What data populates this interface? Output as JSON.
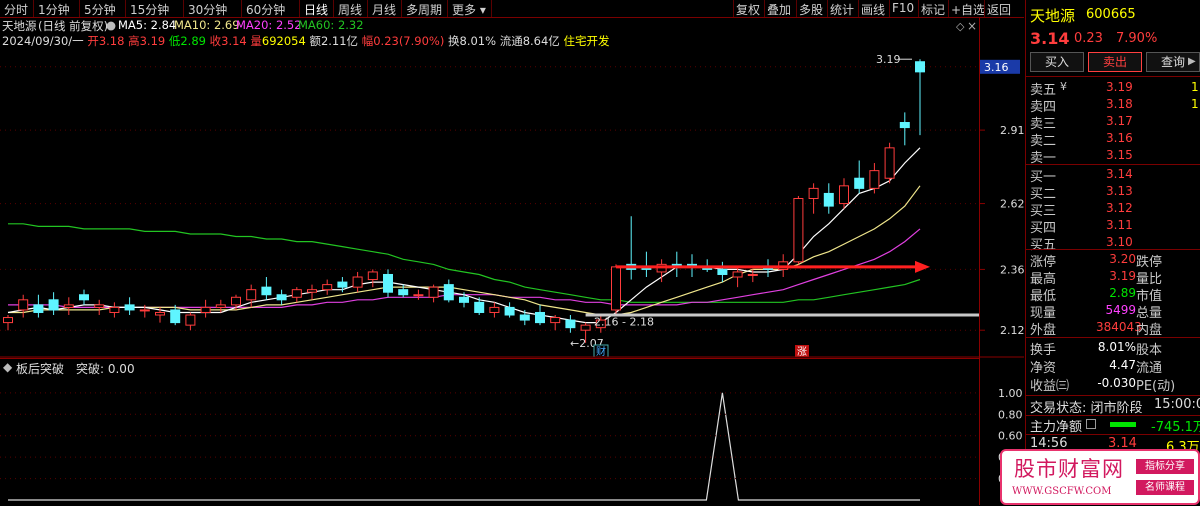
{
  "toolbar": {
    "periods": [
      "分时",
      "1分钟",
      "5分钟",
      "15分钟",
      "30分钟",
      "60分钟",
      "日线",
      "周线",
      "月线",
      "多周期",
      "更多"
    ],
    "active_period": "日线",
    "right": [
      "复权",
      "叠加",
      "多股",
      "统计",
      "画线",
      "F10",
      "标记",
      "+自选",
      "返回"
    ]
  },
  "info": {
    "name": "天地源",
    "mode": "(日线 前复权)",
    "ma5": "MA5: 2.84",
    "ma10": "MA10: 2.69",
    "ma20": "MA20: 2.52",
    "ma60": "MA60: 2.32",
    "date": "2024/09/30/一",
    "open_l": "开",
    "open": "3.18",
    "high_l": "高",
    "high": "3.19",
    "low_l": "低",
    "low": "2.89",
    "close_l": "收",
    "close": "3.14",
    "vol_l": "量",
    "vol": "692054",
    "amt": "额2.11亿",
    "amp_l": "幅",
    "amp": "0.23(7.90%)",
    "turn": "换8.01%",
    "float": "流通8.64亿",
    "sector": "住宅开发"
  },
  "price_axis": {
    "labels": [
      "3.16",
      "2.91",
      "2.62",
      "2.36",
      "2.12"
    ]
  },
  "annotations": {
    "high_label": "3.19",
    "low_label": "2.07",
    "range_label": "2.16 - 2.18",
    "cai": "财",
    "zhang": "涨"
  },
  "sub": {
    "title": "板后突破",
    "value": "突破: 0.00",
    "axis": [
      "1.00",
      "0.80",
      "0.60",
      "0.40",
      "0.20"
    ]
  },
  "chart_data": {
    "type": "candlestick",
    "series_colors": {
      "up": "#ff3c3c",
      "down": "#5ff5ff",
      "ma5": "#ffffff",
      "ma10": "#f0e68c",
      "ma20": "#e040e0",
      "ma60": "#22c422"
    },
    "candles": [
      {
        "o": 2.15,
        "h": 2.18,
        "l": 2.12,
        "c": 2.17
      },
      {
        "o": 2.2,
        "h": 2.26,
        "l": 2.17,
        "c": 2.24
      },
      {
        "o": 2.22,
        "h": 2.26,
        "l": 2.17,
        "c": 2.19
      },
      {
        "o": 2.24,
        "h": 2.27,
        "l": 2.18,
        "c": 2.2
      },
      {
        "o": 2.21,
        "h": 2.25,
        "l": 2.18,
        "c": 2.22
      },
      {
        "o": 2.26,
        "h": 2.28,
        "l": 2.22,
        "c": 2.24
      },
      {
        "o": 2.21,
        "h": 2.24,
        "l": 2.18,
        "c": 2.22
      },
      {
        "o": 2.19,
        "h": 2.23,
        "l": 2.17,
        "c": 2.21
      },
      {
        "o": 2.22,
        "h": 2.25,
        "l": 2.18,
        "c": 2.2
      },
      {
        "o": 2.2,
        "h": 2.22,
        "l": 2.17,
        "c": 2.2
      },
      {
        "o": 2.18,
        "h": 2.21,
        "l": 2.15,
        "c": 2.19
      },
      {
        "o": 2.2,
        "h": 2.22,
        "l": 2.14,
        "c": 2.15
      },
      {
        "o": 2.14,
        "h": 2.19,
        "l": 2.12,
        "c": 2.18
      },
      {
        "o": 2.19,
        "h": 2.24,
        "l": 2.17,
        "c": 2.21
      },
      {
        "o": 2.21,
        "h": 2.24,
        "l": 2.19,
        "c": 2.22
      },
      {
        "o": 2.22,
        "h": 2.26,
        "l": 2.2,
        "c": 2.25
      },
      {
        "o": 2.24,
        "h": 2.3,
        "l": 2.21,
        "c": 2.28
      },
      {
        "o": 2.29,
        "h": 2.33,
        "l": 2.24,
        "c": 2.26
      },
      {
        "o": 2.26,
        "h": 2.28,
        "l": 2.22,
        "c": 2.24
      },
      {
        "o": 2.25,
        "h": 2.29,
        "l": 2.23,
        "c": 2.28
      },
      {
        "o": 2.27,
        "h": 2.3,
        "l": 2.24,
        "c": 2.28
      },
      {
        "o": 2.28,
        "h": 2.32,
        "l": 2.26,
        "c": 2.3
      },
      {
        "o": 2.31,
        "h": 2.33,
        "l": 2.27,
        "c": 2.29
      },
      {
        "o": 2.29,
        "h": 2.35,
        "l": 2.27,
        "c": 2.33
      },
      {
        "o": 2.32,
        "h": 2.36,
        "l": 2.29,
        "c": 2.35
      },
      {
        "o": 2.34,
        "h": 2.36,
        "l": 2.25,
        "c": 2.27
      },
      {
        "o": 2.28,
        "h": 2.3,
        "l": 2.25,
        "c": 2.26
      },
      {
        "o": 2.26,
        "h": 2.28,
        "l": 2.24,
        "c": 2.26
      },
      {
        "o": 2.25,
        "h": 2.3,
        "l": 2.23,
        "c": 2.29
      },
      {
        "o": 2.3,
        "h": 2.32,
        "l": 2.23,
        "c": 2.24
      },
      {
        "o": 2.25,
        "h": 2.27,
        "l": 2.21,
        "c": 2.23
      },
      {
        "o": 2.23,
        "h": 2.25,
        "l": 2.18,
        "c": 2.19
      },
      {
        "o": 2.19,
        "h": 2.23,
        "l": 2.17,
        "c": 2.21
      },
      {
        "o": 2.21,
        "h": 2.23,
        "l": 2.17,
        "c": 2.18
      },
      {
        "o": 2.18,
        "h": 2.2,
        "l": 2.14,
        "c": 2.16
      },
      {
        "o": 2.19,
        "h": 2.22,
        "l": 2.14,
        "c": 2.15
      },
      {
        "o": 2.15,
        "h": 2.18,
        "l": 2.12,
        "c": 2.17
      },
      {
        "o": 2.16,
        "h": 2.18,
        "l": 2.11,
        "c": 2.13
      },
      {
        "o": 2.12,
        "h": 2.15,
        "l": 2.07,
        "c": 2.14
      },
      {
        "o": 2.13,
        "h": 2.18,
        "l": 2.11,
        "c": 2.16
      },
      {
        "o": 2.2,
        "h": 2.38,
        "l": 2.18,
        "c": 2.37
      },
      {
        "o": 2.38,
        "h": 2.57,
        "l": 2.32,
        "c": 2.36
      },
      {
        "o": 2.37,
        "h": 2.43,
        "l": 2.33,
        "c": 2.36
      },
      {
        "o": 2.35,
        "h": 2.4,
        "l": 2.31,
        "c": 2.38
      },
      {
        "o": 2.38,
        "h": 2.43,
        "l": 2.33,
        "c": 2.37
      },
      {
        "o": 2.38,
        "h": 2.42,
        "l": 2.33,
        "c": 2.37
      },
      {
        "o": 2.37,
        "h": 2.4,
        "l": 2.35,
        "c": 2.36
      },
      {
        "o": 2.36,
        "h": 2.39,
        "l": 2.31,
        "c": 2.34
      },
      {
        "o": 2.33,
        "h": 2.37,
        "l": 2.29,
        "c": 2.35
      },
      {
        "o": 2.34,
        "h": 2.36,
        "l": 2.31,
        "c": 2.34
      },
      {
        "o": 2.37,
        "h": 2.4,
        "l": 2.33,
        "c": 2.36
      },
      {
        "o": 2.36,
        "h": 2.42,
        "l": 2.33,
        "c": 2.39
      },
      {
        "o": 2.39,
        "h": 2.65,
        "l": 2.38,
        "c": 2.64
      },
      {
        "o": 2.64,
        "h": 2.7,
        "l": 2.58,
        "c": 2.68
      },
      {
        "o": 2.66,
        "h": 2.7,
        "l": 2.58,
        "c": 2.61
      },
      {
        "o": 2.62,
        "h": 2.72,
        "l": 2.6,
        "c": 2.69
      },
      {
        "o": 2.72,
        "h": 2.79,
        "l": 2.66,
        "c": 2.68
      },
      {
        "o": 2.68,
        "h": 2.78,
        "l": 2.66,
        "c": 2.75
      },
      {
        "o": 2.72,
        "h": 2.86,
        "l": 2.7,
        "c": 2.84
      },
      {
        "o": 2.94,
        "h": 2.98,
        "l": 2.85,
        "c": 2.92
      },
      {
        "o": 3.18,
        "h": 3.19,
        "l": 2.89,
        "c": 3.14
      }
    ],
    "ma5": [
      2.19,
      2.2,
      2.21,
      2.2,
      2.21,
      2.22,
      2.22,
      2.21,
      2.21,
      2.21,
      2.2,
      2.19,
      2.19,
      2.19,
      2.19,
      2.21,
      2.23,
      2.24,
      2.25,
      2.26,
      2.27,
      2.28,
      2.28,
      2.3,
      2.31,
      2.31,
      2.3,
      2.29,
      2.28,
      2.27,
      2.26,
      2.24,
      2.23,
      2.21,
      2.19,
      2.18,
      2.17,
      2.16,
      2.15,
      2.15,
      2.19,
      2.24,
      2.29,
      2.33,
      2.37,
      2.37,
      2.37,
      2.36,
      2.36,
      2.35,
      2.35,
      2.36,
      2.42,
      2.49,
      2.54,
      2.6,
      2.66,
      2.68,
      2.71,
      2.78,
      2.84
    ],
    "ma10": [
      2.19,
      2.19,
      2.2,
      2.2,
      2.2,
      2.2,
      2.2,
      2.21,
      2.21,
      2.21,
      2.21,
      2.21,
      2.2,
      2.2,
      2.2,
      2.2,
      2.21,
      2.22,
      2.22,
      2.23,
      2.24,
      2.25,
      2.26,
      2.27,
      2.28,
      2.29,
      2.29,
      2.29,
      2.29,
      2.29,
      2.28,
      2.27,
      2.26,
      2.25,
      2.24,
      2.22,
      2.21,
      2.2,
      2.19,
      2.18,
      2.18,
      2.19,
      2.21,
      2.23,
      2.25,
      2.27,
      2.29,
      2.31,
      2.34,
      2.36,
      2.36,
      2.36,
      2.38,
      2.41,
      2.43,
      2.46,
      2.49,
      2.52,
      2.56,
      2.61,
      2.69
    ],
    "ma20": [
      2.22,
      2.22,
      2.22,
      2.22,
      2.21,
      2.21,
      2.21,
      2.21,
      2.21,
      2.21,
      2.21,
      2.21,
      2.21,
      2.21,
      2.21,
      2.21,
      2.21,
      2.21,
      2.21,
      2.22,
      2.22,
      2.23,
      2.23,
      2.24,
      2.24,
      2.25,
      2.25,
      2.25,
      2.25,
      2.26,
      2.26,
      2.26,
      2.26,
      2.25,
      2.25,
      2.25,
      2.24,
      2.24,
      2.23,
      2.23,
      2.22,
      2.22,
      2.22,
      2.22,
      2.22,
      2.23,
      2.23,
      2.24,
      2.25,
      2.26,
      2.27,
      2.28,
      2.3,
      2.32,
      2.34,
      2.36,
      2.38,
      2.4,
      2.43,
      2.47,
      2.52
    ],
    "ma60": [
      2.54,
      2.54,
      2.53,
      2.53,
      2.53,
      2.52,
      2.52,
      2.52,
      2.52,
      2.51,
      2.51,
      2.51,
      2.5,
      2.5,
      2.5,
      2.49,
      2.49,
      2.48,
      2.48,
      2.47,
      2.47,
      2.46,
      2.45,
      2.44,
      2.43,
      2.42,
      2.4,
      2.39,
      2.38,
      2.36,
      2.35,
      2.34,
      2.32,
      2.31,
      2.29,
      2.28,
      2.27,
      2.26,
      2.25,
      2.24,
      2.24,
      2.23,
      2.23,
      2.23,
      2.23,
      2.23,
      2.23,
      2.23,
      2.23,
      2.23,
      2.23,
      2.23,
      2.24,
      2.24,
      2.25,
      2.26,
      2.27,
      2.28,
      2.29,
      2.3,
      2.32
    ],
    "ylim": [
      2.03,
      3.25
    ],
    "indicator": {
      "name": "板后突破",
      "values_len": 61,
      "peak_index": 47,
      "peak_value": 1.0,
      "ylim": [
        0,
        1.12
      ]
    }
  },
  "panel": {
    "name": "天地源",
    "code": "600665",
    "price": "3.14",
    "change": "0.23",
    "pct": "7.90%",
    "buttons": [
      "买入",
      "卖出",
      "查询"
    ],
    "asks": [
      {
        "label": "卖五",
        "price": "3.19",
        "vol": "1"
      },
      {
        "label": "卖四",
        "price": "3.18",
        "vol": "1"
      },
      {
        "label": "卖三",
        "price": "3.17",
        "vol": ""
      },
      {
        "label": "卖二",
        "price": "3.16",
        "vol": ""
      },
      {
        "label": "卖一",
        "price": "3.15",
        "vol": ""
      }
    ],
    "bids": [
      {
        "label": "买一",
        "price": "3.14",
        "vol": ""
      },
      {
        "label": "买二",
        "price": "3.13",
        "vol": ""
      },
      {
        "label": "买三",
        "price": "3.12",
        "vol": ""
      },
      {
        "label": "买四",
        "price": "3.11",
        "vol": ""
      },
      {
        "label": "买五",
        "price": "3.10",
        "vol": ""
      }
    ],
    "stats": [
      {
        "l": "涨停",
        "v": "3.20",
        "l2": "跌停",
        "vc": "red"
      },
      {
        "l": "最高",
        "v": "3.19",
        "l2": "量比",
        "vc": "red"
      },
      {
        "l": "最低",
        "v": "2.89",
        "l2": "市值",
        "vc": "green"
      },
      {
        "l": "现量",
        "v": "5499",
        "l2": "总量",
        "vc": "mag"
      },
      {
        "l": "外盘",
        "v": "384043",
        "l2": "内盘",
        "vc": "red"
      }
    ],
    "stats2": [
      {
        "l": "换手",
        "v": "8.01%",
        "l2": "股本"
      },
      {
        "l": "净资",
        "v": "4.47",
        "l2": "流通"
      },
      {
        "l": "收益㈢",
        "v": "-0.030",
        "l2": "PE(动)"
      }
    ],
    "status": "交易状态: 闭市阶段",
    "status_time": "15:00:0",
    "flow_label": "主力净额",
    "flow_val": "-745.1万",
    "tick": {
      "time": "14:56",
      "price": "3.14",
      "vol": "6.3万"
    }
  },
  "watermark": {
    "title": "股市财富网",
    "url": "WWW.GSCFW.COM",
    "tag1": "指标分享",
    "tag2": "名师课程"
  }
}
